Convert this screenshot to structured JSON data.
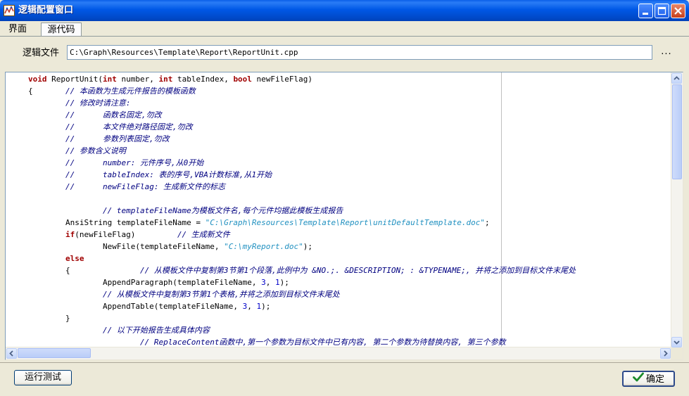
{
  "window": {
    "title": "逻辑配置窗口"
  },
  "tabs": [
    {
      "label": "界面",
      "active": false
    },
    {
      "label": "源代码",
      "active": true
    }
  ],
  "file_row": {
    "label": "逻辑文件",
    "path": "C:\\Graph\\Resources\\Template\\Report\\ReportUnit.cpp",
    "browse": "..."
  },
  "code": {
    "lines": [
      "void ReportUnit(int number, int tableIndex, bool newFileFlag)",
      "{\t// 本函数为生成元件报告的模板函数",
      "\t// 修改时请注意:",
      "\t//\t函数名固定,勿改",
      "\t//\t本文件绝对路径固定,勿改",
      "\t//\t参数列表固定,勿改",
      "\t// 参数含义说明",
      "\t//\tnumber: 元件序号,从0开始",
      "\t//\ttableIndex: 表的序号,VBA计数标准,从1开始",
      "\t//\tnewFileFlag: 生成新文件的标志",
      "",
      "\t\t// templateFileName为模板文件名,每个元件均据此模板生成报告",
      "\tAnsiString templateFileName = \"C:\\Graph\\Resources\\Template\\Report\\unitDefaultTemplate.doc\";",
      "\tif(newFileFlag)\t\t// 生成新文件",
      "\t\tNewFile(templateFileName, \"C:\\myReport.doc\");",
      "\telse",
      "\t{\t\t// 从模板文件中复制第3节第1个段落,此例中为 &NO.;. &DESCRIPTION; : &TYPENAME;, 并将之添加到目标文件末尾处",
      "\t\tAppendParagraph(templateFileName, 3, 1);",
      "\t\t// 从模板文件中复制第3节第1个表格,并将之添加到目标文件末尾处",
      "\t\tAppendTable(templateFileName, 3, 1);",
      "\t}",
      "\t\t// 以下开始报告生成具体内容",
      "\t\t\t// ReplaceContent函数中,第一个参数为目标文件中已有内容, 第二个参数为待替换内容, 第三个参数"
    ]
  },
  "buttons": {
    "run": "运行测试",
    "ok": "确定"
  },
  "icons": {
    "app": "logic-app-icon",
    "minimize": "minimize-icon",
    "maximize": "maximize-icon",
    "close": "close-icon",
    "ok": "checkmark-icon",
    "scroll_up": "arrow-up-icon",
    "scroll_down": "arrow-down-icon",
    "scroll_left": "arrow-left-icon",
    "scroll_right": "arrow-right-icon"
  },
  "colors": {
    "titlebar": "#0058e6",
    "keyword": "#a00000",
    "number": "#0000c8",
    "string": "#2090c0",
    "comment": "#000080",
    "dialog": "#ece9d8"
  }
}
